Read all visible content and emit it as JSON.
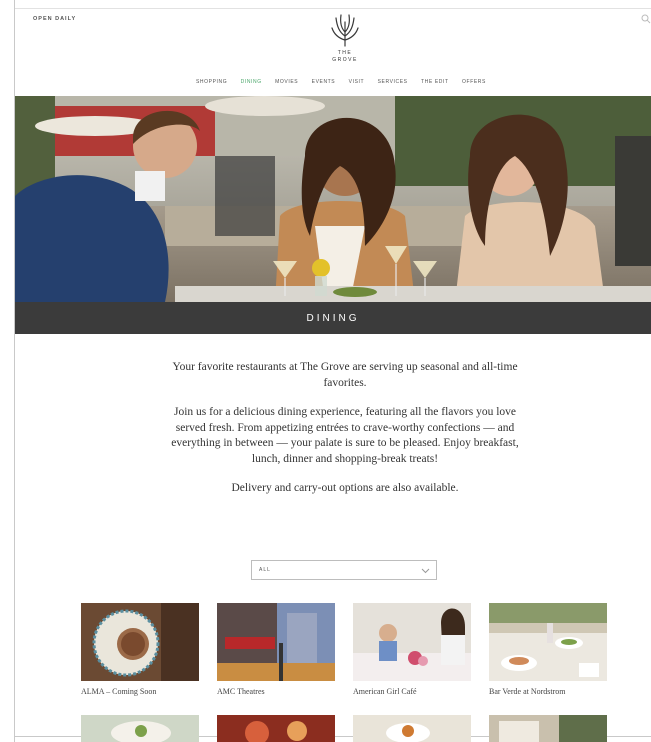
{
  "header": {
    "open_daily": "OPEN DAILY",
    "logo_line1": "THE",
    "logo_line2": "GROVE",
    "nav": [
      "SHOPPING",
      "DINING",
      "MOVIES",
      "EVENTS",
      "VISIT",
      "SERVICES",
      "THE EDIT",
      "OFFERS"
    ],
    "active_nav": "DINING"
  },
  "banner": {
    "title": "DINING"
  },
  "intro": {
    "p1": "Your favorite restaurants at The Grove are serving up seasonal and all-time favorites.",
    "p2": "Join us for a delicious dining experience, featuring all the flavors you love served fresh. From appetizing entrées to crave-worthy confections — and everything in between — your palate is sure to be pleased. Enjoy breakfast, lunch, dinner and shopping-break treats!",
    "p3": "Delivery and carry-out options are also available."
  },
  "filter": {
    "value": "ALL"
  },
  "restaurants": [
    {
      "name": "ALMA – Coming Soon"
    },
    {
      "name": "AMC Theatres"
    },
    {
      "name": "American Girl Café"
    },
    {
      "name": "Bar Verde at Nordstrom"
    }
  ],
  "colors": {
    "active_nav": "#4aa66a",
    "banner_bg": "#3b3b3b",
    "text": "#333333"
  }
}
